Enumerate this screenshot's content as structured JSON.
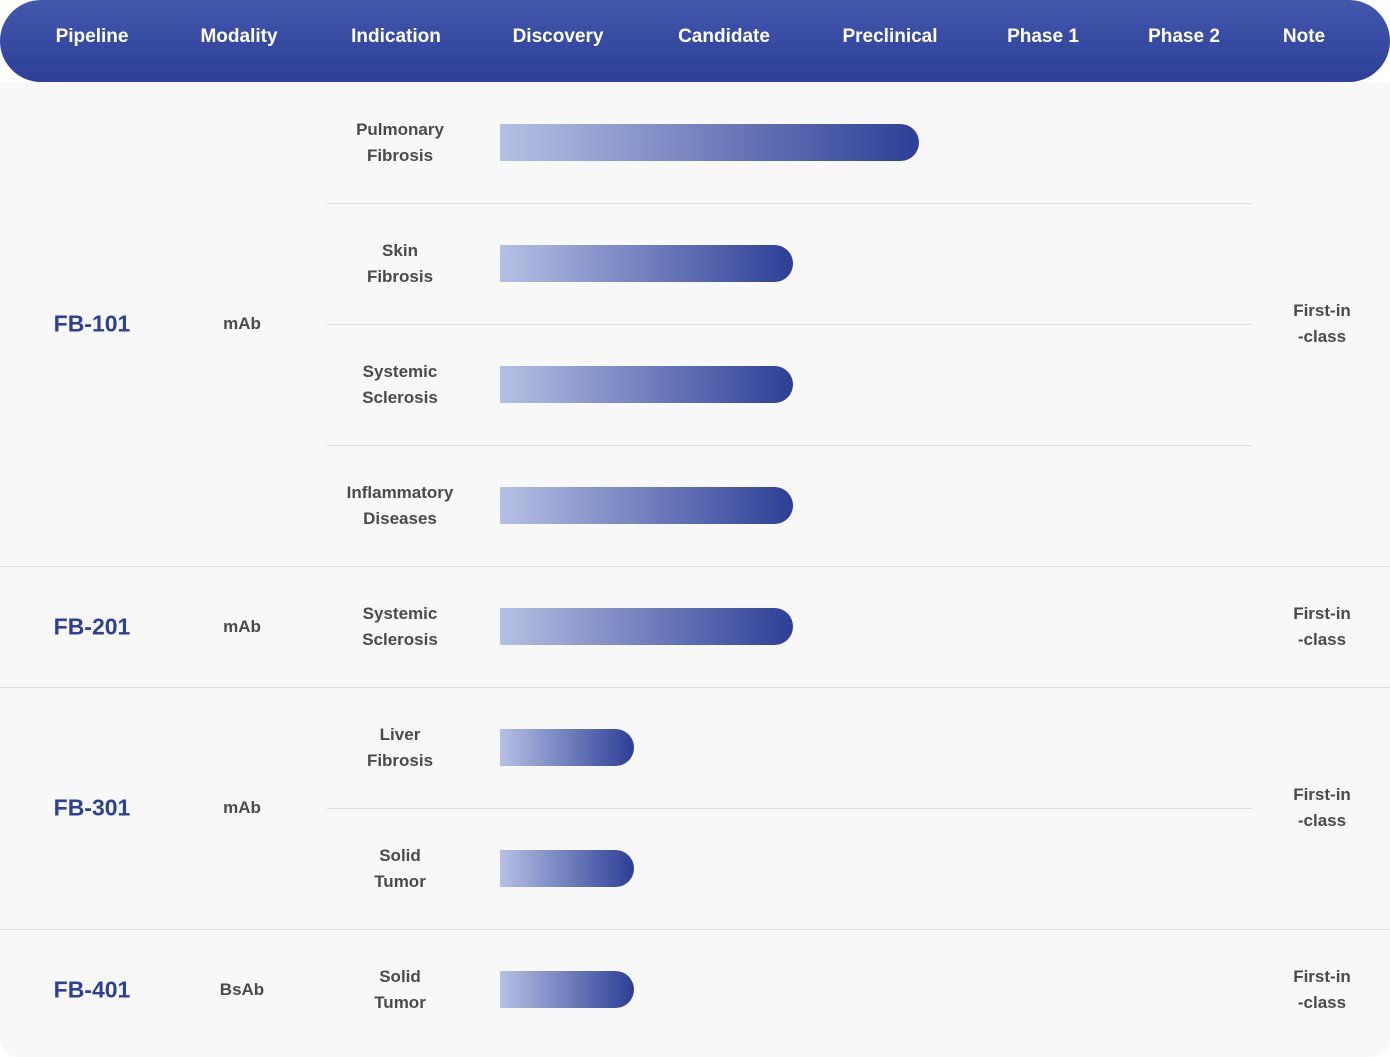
{
  "header": {
    "columns": [
      "Pipeline",
      "Modality",
      "Indication",
      "Discovery",
      "Candidate",
      "Preclinical",
      "Phase 1",
      "Phase 2",
      "Note"
    ]
  },
  "colors": {
    "header_bg": "#2d3f97",
    "bar_start": "#b6c0e4",
    "bar_end": "#2d3f97",
    "pipeline_text": "#2e4096"
  },
  "chart_data": {
    "type": "bar",
    "stages": [
      "Discovery",
      "Candidate",
      "Preclinical",
      "Phase 1",
      "Phase 2"
    ],
    "groups": [
      {
        "pipeline": "FB-101",
        "modality": "mAb",
        "note": [
          "First-in",
          "-class"
        ],
        "rows": [
          {
            "indication": [
              "Pulmonary",
              "Fibrosis"
            ],
            "progress": 2.5
          },
          {
            "indication": [
              "Skin",
              "Fibrosis"
            ],
            "progress": 1.75
          },
          {
            "indication": [
              "Systemic",
              "Sclerosis"
            ],
            "progress": 1.75
          },
          {
            "indication": [
              "Inflammatory",
              "Diseases"
            ],
            "progress": 1.75
          }
        ]
      },
      {
        "pipeline": "FB-201",
        "modality": "mAb",
        "note": [
          "First-in",
          "-class"
        ],
        "rows": [
          {
            "indication": [
              "Systemic",
              "Sclerosis"
            ],
            "progress": 1.75
          }
        ]
      },
      {
        "pipeline": "FB-301",
        "modality": "mAb",
        "note": [
          "First-in",
          "-class"
        ],
        "rows": [
          {
            "indication": [
              "Liver",
              "Fibrosis"
            ],
            "progress": 0.8
          },
          {
            "indication": [
              "Solid",
              "Tumor"
            ],
            "progress": 0.8
          }
        ]
      },
      {
        "pipeline": "FB-401",
        "modality": "BsAb",
        "note": [
          "First-in",
          "-class"
        ],
        "rows": [
          {
            "indication": [
              "Solid",
              "Tumor"
            ],
            "progress": 0.8
          }
        ]
      }
    ]
  }
}
